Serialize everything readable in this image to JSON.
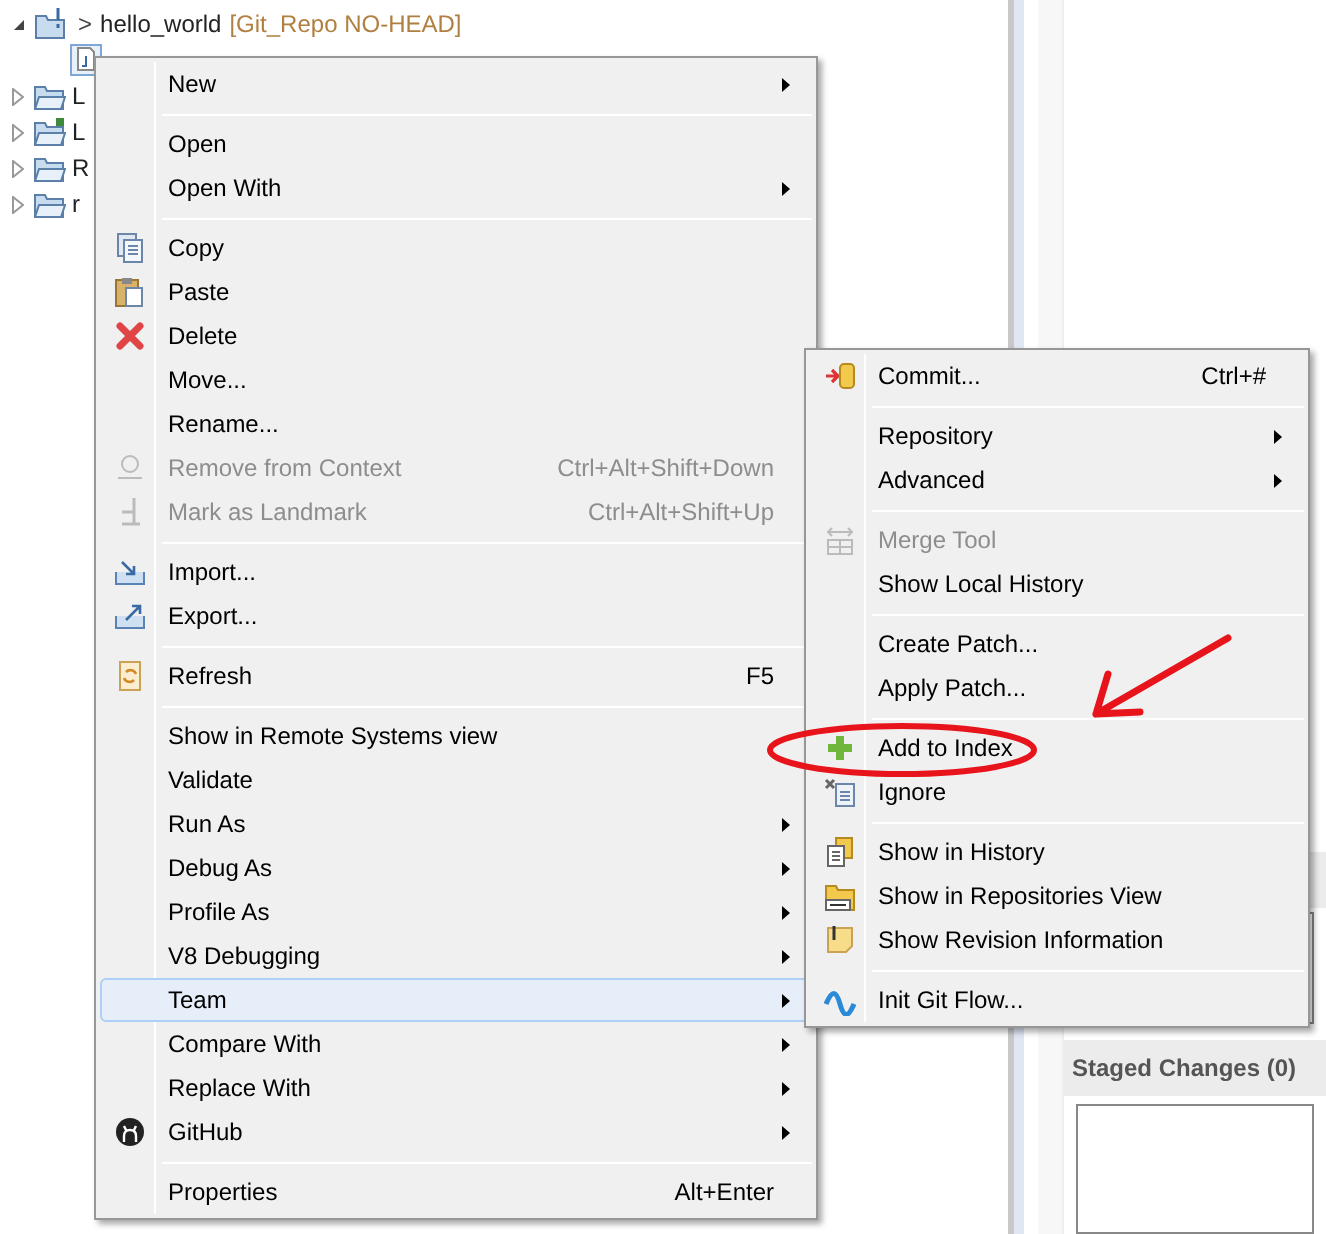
{
  "tree": {
    "root": {
      "label": "hello_world",
      "arrow": ">",
      "repo": "[Git_Repo NO-HEAD]",
      "expanded": true
    },
    "children": [
      {
        "label": "L",
        "expanded": false
      },
      {
        "label": "L",
        "expanded": false
      },
      {
        "label": "R",
        "expanded": false
      },
      {
        "label": "r",
        "expanded": false
      }
    ]
  },
  "right_panel": {
    "staged_header": "Staged Changes (0)"
  },
  "context_menu": [
    {
      "kind": "item",
      "label": "New",
      "submenu": true,
      "disabled": false,
      "selected": false
    },
    {
      "kind": "separator"
    },
    {
      "kind": "item",
      "label": "Open",
      "submenu": false,
      "disabled": false,
      "selected": false
    },
    {
      "kind": "item",
      "label": "Open With",
      "submenu": true,
      "disabled": false,
      "selected": false
    },
    {
      "kind": "separator"
    },
    {
      "kind": "item",
      "label": "Copy",
      "submenu": false,
      "disabled": false,
      "selected": false
    },
    {
      "kind": "item",
      "label": "Paste",
      "submenu": false,
      "disabled": false,
      "selected": false
    },
    {
      "kind": "item",
      "label": "Delete",
      "submenu": false,
      "disabled": false,
      "selected": false
    },
    {
      "kind": "item",
      "label": "Move...",
      "submenu": false,
      "disabled": false,
      "selected": false
    },
    {
      "kind": "item",
      "label": "Rename...",
      "submenu": false,
      "disabled": false,
      "selected": false
    },
    {
      "kind": "item",
      "label": "Remove from Context",
      "shortcut": "Ctrl+Alt+Shift+Down",
      "submenu": false,
      "disabled": true,
      "selected": false
    },
    {
      "kind": "item",
      "label": "Mark as Landmark",
      "shortcut": "Ctrl+Alt+Shift+Up",
      "submenu": false,
      "disabled": true,
      "selected": false
    },
    {
      "kind": "separator"
    },
    {
      "kind": "item",
      "label": "Import...",
      "submenu": false,
      "disabled": false,
      "selected": false
    },
    {
      "kind": "item",
      "label": "Export...",
      "submenu": false,
      "disabled": false,
      "selected": false
    },
    {
      "kind": "separator"
    },
    {
      "kind": "item",
      "label": "Refresh",
      "shortcut": "F5",
      "submenu": false,
      "disabled": false,
      "selected": false
    },
    {
      "kind": "separator"
    },
    {
      "kind": "item",
      "label": "Show in Remote Systems view",
      "submenu": false,
      "disabled": false,
      "selected": false
    },
    {
      "kind": "item",
      "label": "Validate",
      "submenu": false,
      "disabled": false,
      "selected": false
    },
    {
      "kind": "item",
      "label": "Run As",
      "submenu": true,
      "disabled": false,
      "selected": false
    },
    {
      "kind": "item",
      "label": "Debug As",
      "submenu": true,
      "disabled": false,
      "selected": false
    },
    {
      "kind": "item",
      "label": "Profile As",
      "submenu": true,
      "disabled": false,
      "selected": false
    },
    {
      "kind": "item",
      "label": "V8 Debugging",
      "submenu": true,
      "disabled": false,
      "selected": false
    },
    {
      "kind": "item",
      "label": "Team",
      "submenu": true,
      "disabled": false,
      "selected": true
    },
    {
      "kind": "item",
      "label": "Compare With",
      "submenu": true,
      "disabled": false,
      "selected": false
    },
    {
      "kind": "item",
      "label": "Replace With",
      "submenu": true,
      "disabled": false,
      "selected": false
    },
    {
      "kind": "item",
      "label": "GitHub",
      "submenu": true,
      "disabled": false,
      "selected": false
    },
    {
      "kind": "separator"
    },
    {
      "kind": "item",
      "label": "Properties",
      "shortcut": "Alt+Enter",
      "submenu": false,
      "disabled": false,
      "selected": false
    }
  ],
  "team_submenu": [
    {
      "kind": "item",
      "label": "Commit...",
      "shortcut": "Ctrl+#",
      "submenu": false,
      "disabled": false,
      "selected": false
    },
    {
      "kind": "separator"
    },
    {
      "kind": "item",
      "label": "Repository",
      "submenu": true,
      "disabled": false,
      "selected": false
    },
    {
      "kind": "item",
      "label": "Advanced",
      "submenu": true,
      "disabled": false,
      "selected": false
    },
    {
      "kind": "separator"
    },
    {
      "kind": "item",
      "label": "Merge Tool",
      "submenu": false,
      "disabled": true,
      "selected": false
    },
    {
      "kind": "item",
      "label": "Show Local History",
      "submenu": false,
      "disabled": false,
      "selected": false
    },
    {
      "kind": "separator"
    },
    {
      "kind": "item",
      "label": "Create Patch...",
      "submenu": false,
      "disabled": false,
      "selected": false
    },
    {
      "kind": "item",
      "label": "Apply Patch...",
      "submenu": false,
      "disabled": false,
      "selected": false
    },
    {
      "kind": "separator"
    },
    {
      "kind": "item",
      "label": "Add to Index",
      "submenu": false,
      "disabled": false,
      "selected": false
    },
    {
      "kind": "item",
      "label": "Ignore",
      "submenu": false,
      "disabled": false,
      "selected": false
    },
    {
      "kind": "separator"
    },
    {
      "kind": "item",
      "label": "Show in History",
      "submenu": false,
      "disabled": false,
      "selected": false
    },
    {
      "kind": "item",
      "label": "Show in Repositories View",
      "submenu": false,
      "disabled": false,
      "selected": false
    },
    {
      "kind": "item",
      "label": "Show Revision Information",
      "submenu": false,
      "disabled": false,
      "selected": false
    },
    {
      "kind": "separator"
    },
    {
      "kind": "item",
      "label": "Init Git Flow...",
      "submenu": false,
      "disabled": false,
      "selected": false
    }
  ]
}
